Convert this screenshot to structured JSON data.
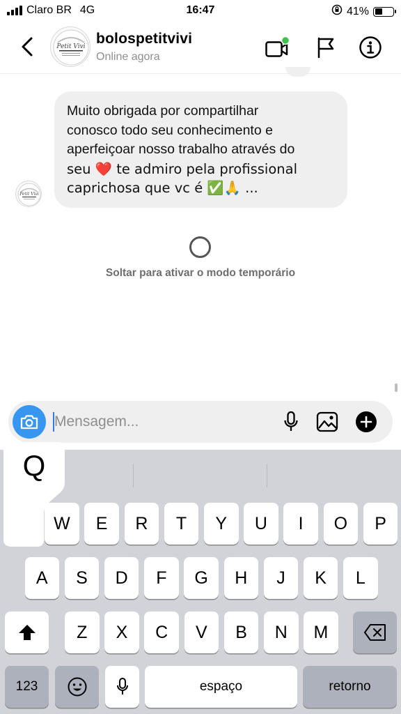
{
  "status_bar": {
    "carrier": "Claro BR",
    "network": "4G",
    "time": "16:47",
    "battery_percent": "41%",
    "battery_level": 0.41
  },
  "header": {
    "username": "bolospetitvivi",
    "status": "Online agora",
    "avatar_text": "Petit Vivi",
    "video_dot_color": "#3ec14a"
  },
  "chat": {
    "messages": [
      {
        "from": "bolospetitvivi",
        "lines": [
          "Muito obrigada por compartilhar",
          "conosco todo seu conhecimento e",
          "aperfeiçoar nosso trabalho através do",
          "seu ❤️ te admiro pela profissional",
          "caprichosa que vc é ✅🙏 ..."
        ]
      }
    ],
    "vanish_hint": "Soltar para ativar o modo temporário"
  },
  "composer": {
    "placeholder": "Mensagem...",
    "value": "",
    "accent_color": "#3797f0"
  },
  "keyboard": {
    "popup_key": "Q",
    "rows": [
      [
        "Q",
        "W",
        "E",
        "R",
        "T",
        "Y",
        "U",
        "I",
        "O",
        "P"
      ],
      [
        "A",
        "S",
        "D",
        "F",
        "G",
        "H",
        "J",
        "K",
        "L"
      ],
      [
        "Z",
        "X",
        "C",
        "V",
        "B",
        "N",
        "M"
      ]
    ],
    "numbers_label": "123",
    "space_label": "espaço",
    "return_label": "retorno"
  }
}
